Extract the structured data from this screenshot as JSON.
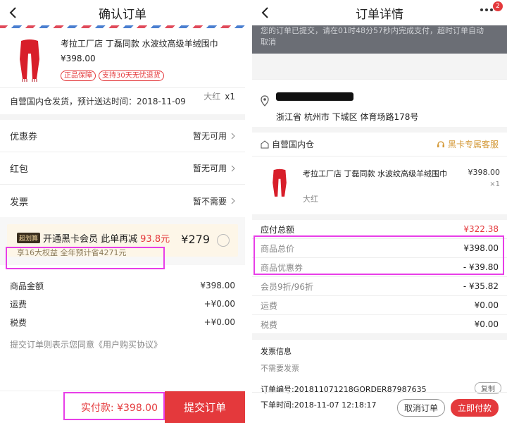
{
  "left": {
    "title": "确认订单",
    "product": {
      "name": "考拉工厂店 丁磊同款 水波纹高级羊绒围巾",
      "price": "¥398.00",
      "color": "大红",
      "qty": "x1",
      "tags": [
        "正品保障",
        "支持30天无忧退货"
      ]
    },
    "shipping": "自营国内仓发货，预计送达时间：2018-11-09",
    "rows": [
      {
        "label": "优惠券",
        "value": "暂无可用"
      },
      {
        "label": "红包",
        "value": "暂无可用"
      },
      {
        "label": "发票",
        "value": "暂不需要"
      }
    ],
    "promo": {
      "chip": "超划算",
      "text": "开通黑卡会员 此单再减",
      "amount": "93.8元",
      "sub": "享16大权益 全年预计省4271元",
      "price": "¥279"
    },
    "amounts": [
      {
        "label": "商品金额",
        "value": "¥398.00"
      },
      {
        "label": "运费",
        "value": "+¥0.00"
      },
      {
        "label": "税费",
        "value": "+¥0.00"
      }
    ],
    "agreement": "提交订单则表示您同意《用户购买协议》",
    "pay_label": "实付款: ¥398.00",
    "submit": "提交订单"
  },
  "right": {
    "title": "订单详情",
    "badge": "2",
    "banner1": "您的订单已提交，请在01时48分57秒内完成支付，超时订单自动",
    "banner2": "取消",
    "address": "浙江省 杭州市 下城区 体育场路178号",
    "store": "自营国内仓",
    "service": "黑卡专属客服",
    "product": {
      "name": "考拉工厂店 丁磊同款 水波纹高级羊绒围巾",
      "price": "¥398.00",
      "qty": "×1",
      "spec": "大红"
    },
    "summary": [
      {
        "label": "应付总额",
        "value": "¥322.38"
      },
      {
        "label": "商品总价",
        "value": "¥398.00"
      },
      {
        "label": "商品优惠券",
        "value": "- ¥39.80"
      },
      {
        "label": "会员9折/96折",
        "value": "- ¥35.82"
      },
      {
        "label": "运费",
        "value": "¥0.00"
      },
      {
        "label": "税费",
        "value": "¥0.00"
      }
    ],
    "invoice_title": "发票信息",
    "invoice_value": "不需要发票",
    "order_no": "订单编号:201811071218GORDER87987635",
    "copy": "复制",
    "order_time": "下单时间:2018-11-07 12:18:17",
    "cancel": "取消订单",
    "pay": "立即付款"
  },
  "colors": {
    "accent": "#e4393c",
    "highlight": "#e83ee8",
    "banner": "#6b6e75"
  }
}
